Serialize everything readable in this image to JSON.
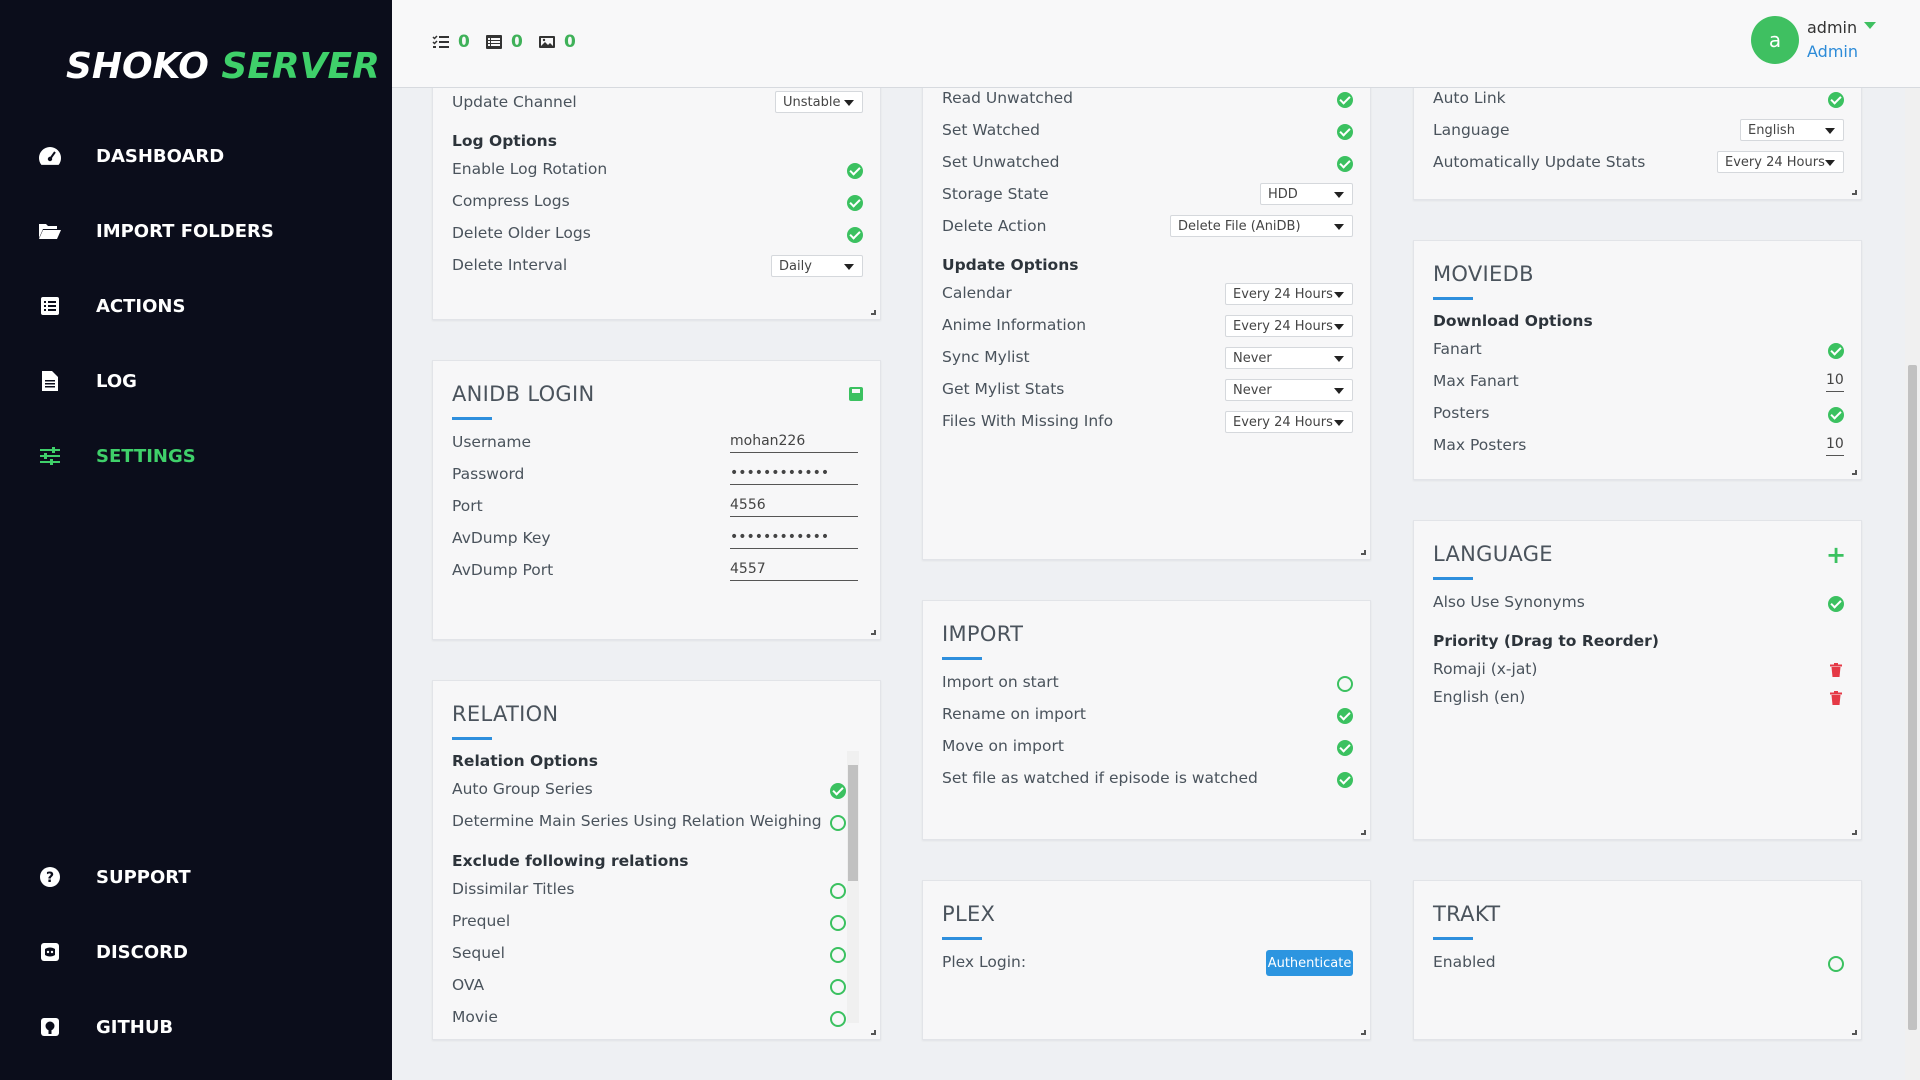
{
  "app": {
    "logo_white": "SHOKO",
    "logo_green": "SERVER"
  },
  "sidebar": {
    "items": [
      {
        "label": "DASHBOARD",
        "icon": "speedometer-icon"
      },
      {
        "label": "IMPORT FOLDERS",
        "icon": "folder-open-icon"
      },
      {
        "label": "ACTIONS",
        "icon": "list-icon"
      },
      {
        "label": "LOG",
        "icon": "file-icon"
      },
      {
        "label": "SETTINGS",
        "icon": "sliders-icon",
        "active": true
      }
    ],
    "bottom_items": [
      {
        "label": "SUPPORT",
        "icon": "question-icon"
      },
      {
        "label": "DISCORD",
        "icon": "discord-icon"
      },
      {
        "label": "GITHUB",
        "icon": "github-icon"
      }
    ]
  },
  "topbar": {
    "queues": [
      {
        "icon": "tasks-icon",
        "count": "0"
      },
      {
        "icon": "list-alt-icon",
        "count": "0"
      },
      {
        "icon": "image-icon",
        "count": "0"
      }
    ],
    "user": {
      "initial": "a",
      "name": "admin",
      "role": "Admin"
    }
  },
  "general": {
    "update_channel_label": "Update Channel",
    "update_channel_value": "Unstable",
    "log_options_heading": "Log Options",
    "enable_log_rotation": "Enable Log Rotation",
    "compress_logs": "Compress Logs",
    "delete_older_logs": "Delete Older Logs",
    "delete_interval_label": "Delete Interval",
    "delete_interval_value": "Daily"
  },
  "anidb_login": {
    "title": "ANIDB LOGIN",
    "username_label": "Username",
    "username_value": "mohan226",
    "password_label": "Password",
    "password_value": "••••••••••••",
    "port_label": "Port",
    "port_value": "4556",
    "avdump_key_label": "AvDump Key",
    "avdump_key_value": "••••••••••••",
    "avdump_port_label": "AvDump Port",
    "avdump_port_value": "4557"
  },
  "relation": {
    "title": "RELATION",
    "options_heading": "Relation Options",
    "auto_group_series": "Auto Group Series",
    "determine_main": "Determine Main Series Using Relation Weighing",
    "exclude_heading": "Exclude following relations",
    "dissimilar_titles": "Dissimilar Titles",
    "prequel": "Prequel",
    "sequel": "Sequel",
    "ova": "OVA",
    "movie": "Movie"
  },
  "anidb": {
    "read_unwatched": "Read Unwatched",
    "set_watched": "Set Watched",
    "set_unwatched": "Set Unwatched",
    "storage_state_label": "Storage State",
    "storage_state_value": "HDD",
    "delete_action_label": "Delete Action",
    "delete_action_value": "Delete File (AniDB)",
    "update_options_heading": "Update Options",
    "calendar_label": "Calendar",
    "calendar_value": "Every 24 Hours",
    "anime_info_label": "Anime Information",
    "anime_info_value": "Every 24 Hours",
    "sync_mylist_label": "Sync Mylist",
    "sync_mylist_value": "Never",
    "get_mylist_stats_label": "Get Mylist Stats",
    "get_mylist_stats_value": "Never",
    "files_missing_label": "Files With Missing Info",
    "files_missing_value": "Every 24 Hours"
  },
  "import": {
    "title": "IMPORT",
    "import_on_start": "Import on start",
    "rename_on_import": "Rename on import",
    "move_on_import": "Move on import",
    "set_file_watched": "Set file as watched if episode is watched"
  },
  "plex": {
    "title": "PLEX",
    "login_label": "Plex Login:",
    "authenticate_button": "Authenticate"
  },
  "tvdb": {
    "auto_link": "Auto Link",
    "language_label": "Language",
    "language_value": "English",
    "auto_update_label": "Automatically Update Stats",
    "auto_update_value": "Every 24 Hours"
  },
  "moviedb": {
    "title": "MOVIEDB",
    "download_heading": "Download Options",
    "fanart": "Fanart",
    "max_fanart_label": "Max Fanart",
    "max_fanart_value": "10",
    "posters": "Posters",
    "max_posters_label": "Max Posters",
    "max_posters_value": "10"
  },
  "language": {
    "title": "LANGUAGE",
    "also_use_synonyms": "Also Use Synonyms",
    "priority_heading": "Priority (Drag to Reorder)",
    "items": [
      "Romaji (x-jat)",
      "English (en)"
    ]
  },
  "trakt": {
    "title": "TRAKT",
    "enabled": "Enabled"
  },
  "colors": {
    "accent_green": "#3fd06a",
    "accent_blue": "#2e8fdd",
    "sidebar_bg": "#0b0d1b",
    "danger_red": "#e53946"
  }
}
